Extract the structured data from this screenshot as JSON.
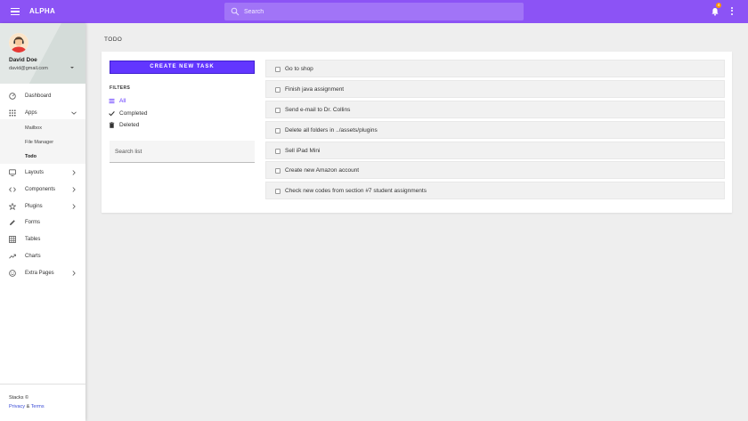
{
  "header": {
    "brand": "ALPHA",
    "search_placeholder": "Search",
    "notification_count": "4"
  },
  "user": {
    "name": "David Doe",
    "email": "david@gmail.com"
  },
  "sidebar": {
    "items": [
      {
        "label": "Dashboard",
        "icon": "dashboard-icon"
      },
      {
        "label": "Apps",
        "icon": "apps-icon",
        "expanded": true
      },
      {
        "label": "Layouts",
        "icon": "monitor-icon"
      },
      {
        "label": "Components",
        "icon": "code-icon"
      },
      {
        "label": "Plugins",
        "icon": "star-icon"
      },
      {
        "label": "Forms",
        "icon": "pencil-icon"
      },
      {
        "label": "Tables",
        "icon": "table-icon"
      },
      {
        "label": "Charts",
        "icon": "trending-up-icon"
      },
      {
        "label": "Extra Pages",
        "icon": "smiley-icon"
      }
    ],
    "apps_subitems": [
      {
        "label": "Mailbox",
        "active": false
      },
      {
        "label": "File Manager",
        "active": false
      },
      {
        "label": "Todo",
        "active": true
      }
    ]
  },
  "footer": {
    "copyright": "Stacks ©",
    "privacy": "Privacy",
    "amp": "&",
    "terms": "Terms"
  },
  "main": {
    "title": "TODO",
    "create_button": "CREATE NEW TASK",
    "filters_title": "FILTERS",
    "filters": [
      {
        "label": "All",
        "icon": "list-icon",
        "active": true
      },
      {
        "label": "Completed",
        "icon": "check-icon",
        "active": false
      },
      {
        "label": "Deleted",
        "icon": "trash-icon",
        "active": false
      }
    ],
    "search_placeholder": "Search list",
    "tasks": [
      {
        "label": "Go to shop",
        "done": false
      },
      {
        "label": "Finish java assignment",
        "done": false
      },
      {
        "label": "Send e-mail to Dr. Collins",
        "done": false
      },
      {
        "label": "Delete all folders in ../assets/plugins",
        "done": false
      },
      {
        "label": "Sell iPad Mini",
        "done": false
      },
      {
        "label": "Create new Amazon account",
        "done": false
      },
      {
        "label": "Check new codes from section #7 student assignments",
        "done": false
      }
    ]
  },
  "colors": {
    "topbar": "#8c53f5",
    "accent": "#6236ff",
    "badge": "#ff9800",
    "link": "#3a4cd6"
  }
}
